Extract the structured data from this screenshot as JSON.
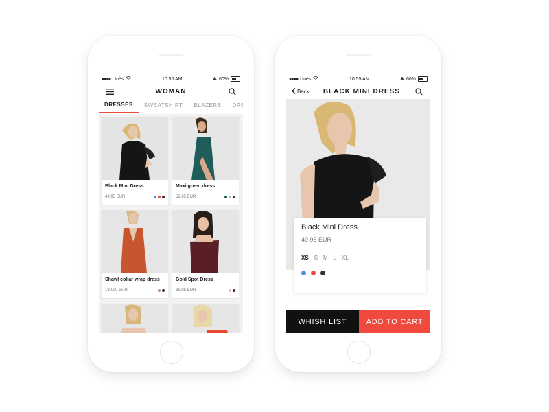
{
  "colors": {
    "accent": "#f04a3e",
    "dark": "#111111",
    "swatch_blue": "#4a90e2",
    "swatch_red": "#f04a3e",
    "swatch_dark": "#333333",
    "swatch_teal": "#1f5c5a",
    "swatch_grey": "#b0b0b0",
    "swatch_pink": "#f3b6b0",
    "swatch_brown": "#c28a72"
  },
  "status": {
    "carrier": "Inès",
    "time": "10:55 AM",
    "battery": "60%"
  },
  "list_screen": {
    "title": "WOMAN",
    "tabs": [
      "DRESSES",
      "SWEATSHIRT",
      "BLAZERS",
      "DRE"
    ],
    "products": [
      {
        "name": "Black Mini Dress",
        "price": "49.95 EUR",
        "swatches": [
          "#4a90e2",
          "#f04a3e",
          "#333333"
        ]
      },
      {
        "name": "Maxi green dress",
        "price": "52.95 EUR",
        "swatches": [
          "#1f5c5a",
          "#b0b0b0",
          "#333333"
        ]
      },
      {
        "name": "Shawl collar wrap dress",
        "price": "139.00 EUR",
        "swatches": [
          "#c28a72",
          "#333333"
        ]
      },
      {
        "name": "Gold Spot Dress",
        "price": "89.95 EUR",
        "swatches": [
          "#f3b6b0",
          "#333333"
        ]
      }
    ]
  },
  "detail_screen": {
    "back_label": "Back",
    "title": "BLACK MINI DRESS",
    "product_name": "Black Mini Dress",
    "price": "49.95 EUR",
    "sizes": [
      "XS",
      "S",
      "M",
      "L",
      "XL"
    ],
    "selected_size": "XS",
    "colors": [
      "#4a90e2",
      "#f04a3e",
      "#333333"
    ],
    "wish_label": "WHISH LIST",
    "cart_label": "ADD TO CART",
    "image_count": 4,
    "active_image": 3
  }
}
